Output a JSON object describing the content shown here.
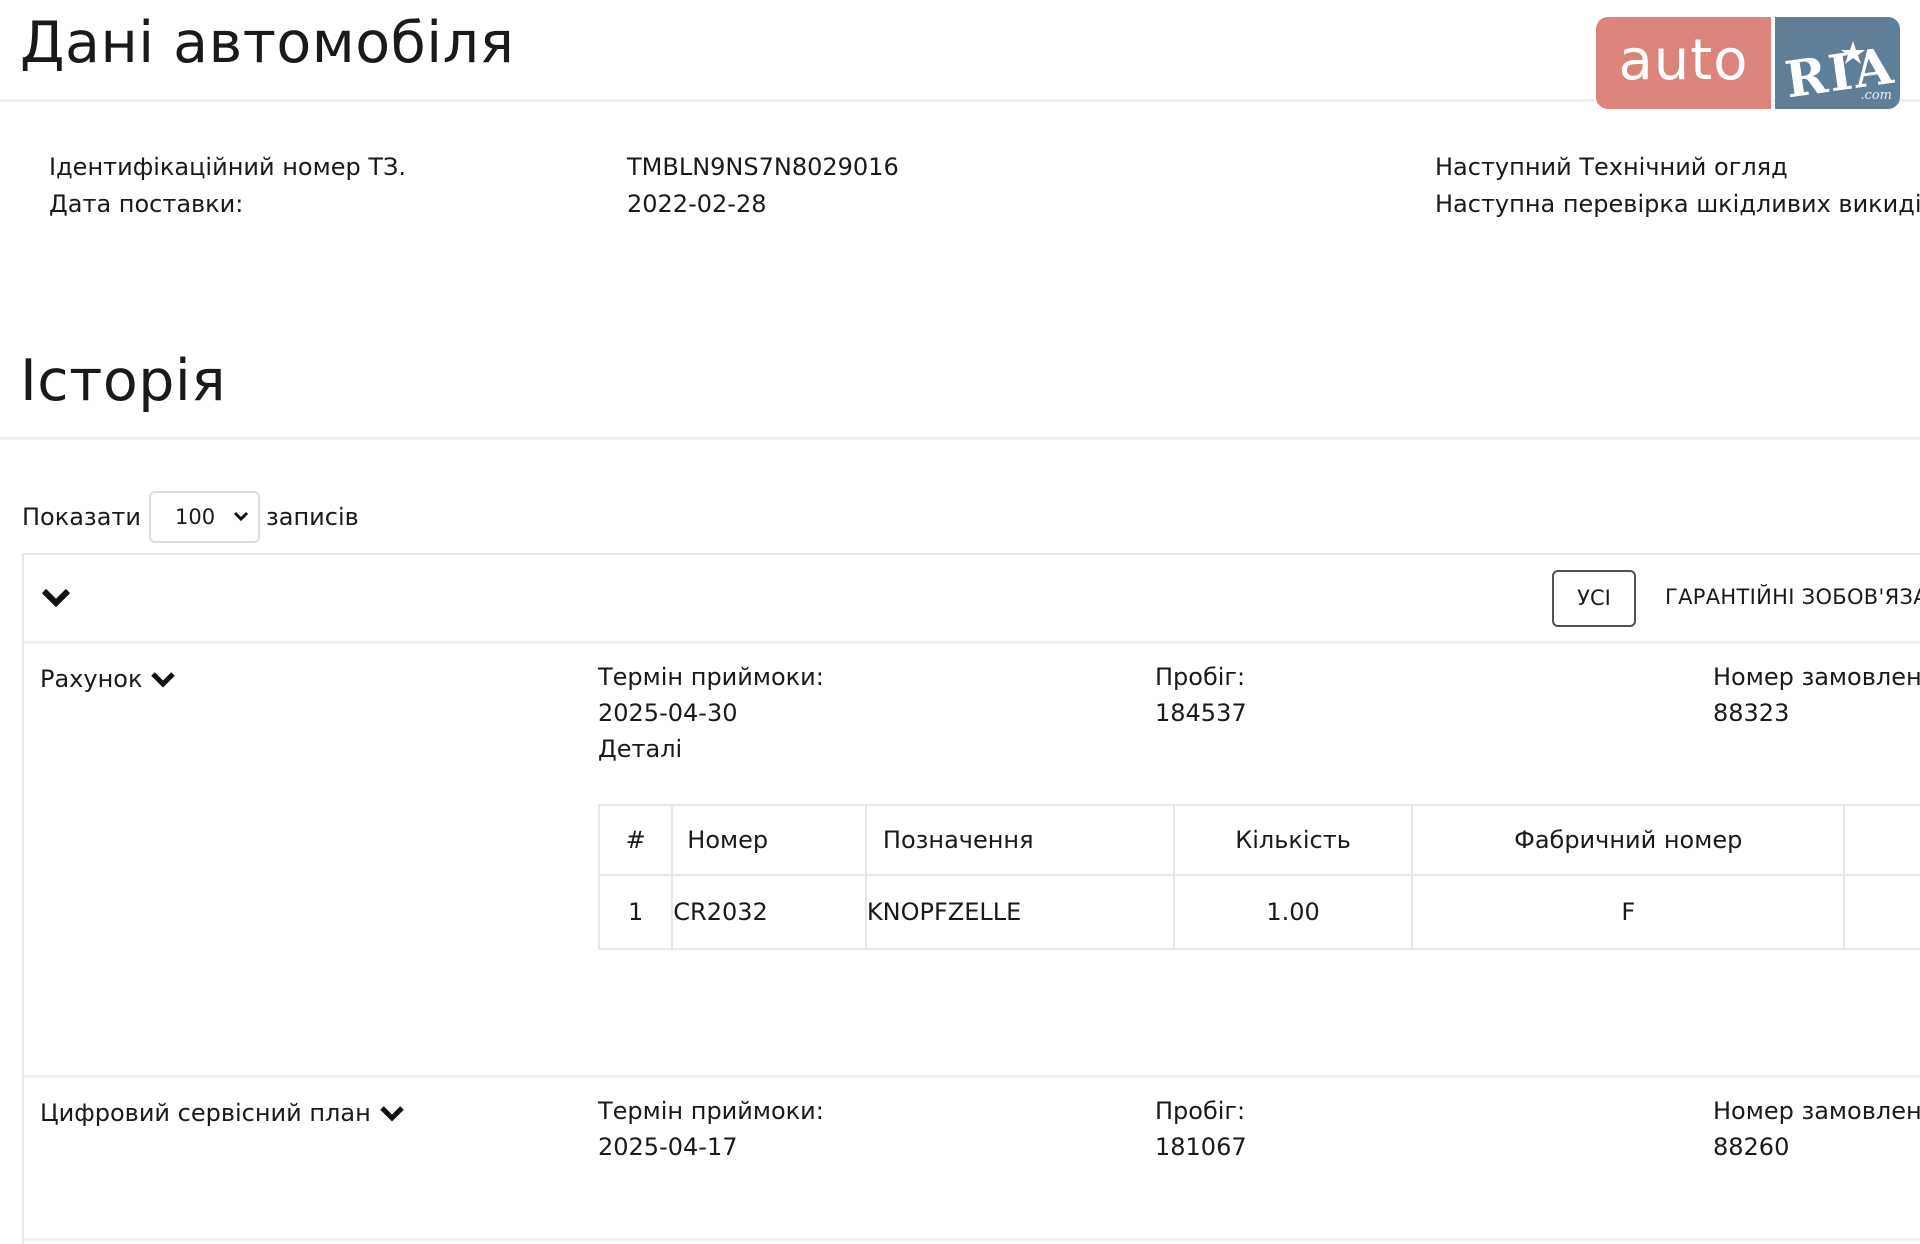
{
  "vehicle": {
    "title": "Дані автомобіля",
    "vin_label": "Ідентифікаційний номер ТЗ.",
    "vin_value": "TMBLN9NS7N8029016",
    "delivery_label": "Дата поставки:",
    "delivery_value": "2022-02-28",
    "next_inspection_label": "Наступний Технічний огляд",
    "next_emissions_label": "Наступна перевірка шкідливих викидів"
  },
  "logo": {
    "auto": "auto",
    "ria": "RIA",
    "com": ".com",
    "colors": {
      "auto_bg": "#db8479",
      "ria_bg": "#5f7f98"
    }
  },
  "history": {
    "title": "Історія",
    "length": {
      "show_label": "Показати",
      "selected": "100",
      "records_label": "записів"
    },
    "filters": {
      "all": "УСІ",
      "warranty": "ГАРАНТІЙНІ ЗОБОВ'ЯЗА"
    },
    "records": [
      {
        "type": "Рахунок",
        "acceptance_label": "Термін приймоки:",
        "acceptance_value": "2025-04-30",
        "details_label": "Деталі",
        "mileage_label": "Пробіг:",
        "mileage_value": "184537",
        "order_label": "Номер замовленн",
        "order_value": "88323",
        "details_table": {
          "headers": [
            "#",
            "Номер",
            "Позначення",
            "Кількість",
            "Фабричний номер"
          ],
          "rows": [
            [
              "1",
              "CR2032",
              "KNOPFZELLE",
              "1.00",
              "F"
            ]
          ]
        }
      },
      {
        "type": "Цифровий сервісний план",
        "acceptance_label": "Термін приймоки:",
        "acceptance_value": "2025-04-17",
        "mileage_label": "Пробіг:",
        "mileage_value": "181067",
        "order_label": "Номер замовленн",
        "order_value": "88260"
      }
    ]
  }
}
